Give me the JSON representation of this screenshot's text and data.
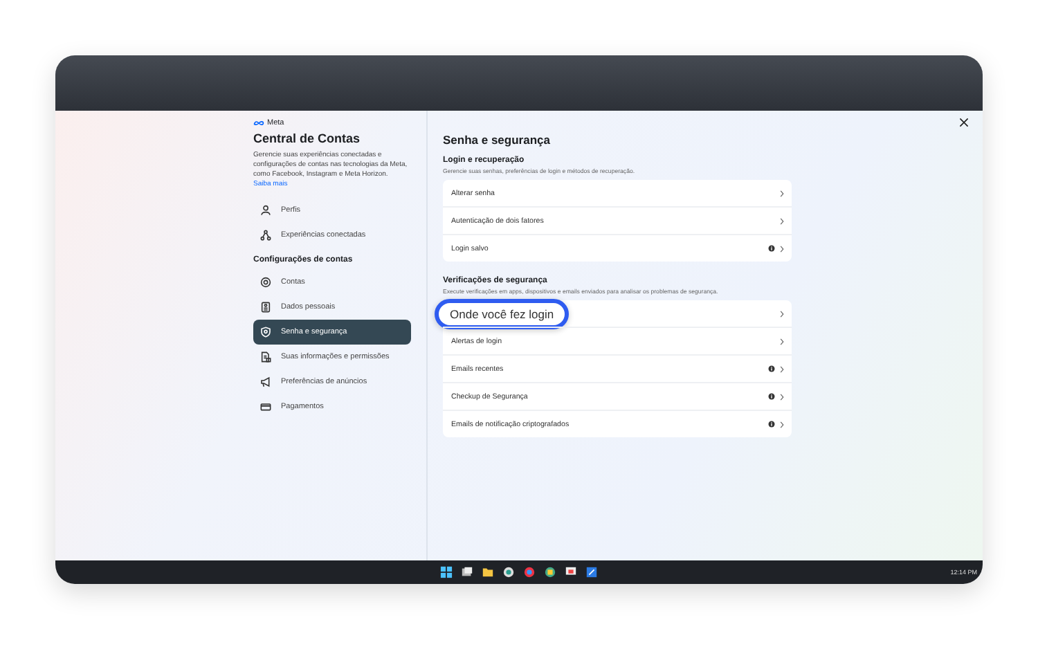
{
  "brand": "Meta",
  "title": "Central de Contas",
  "description": "Gerencie suas experiências conectadas e configurações de contas nas tecnologias da Meta, como Facebook, Instagram e Meta Horizon.",
  "learn_more": "Saiba mais",
  "nav_top": [
    {
      "label": "Perfis",
      "selected": false
    },
    {
      "label": "Experiências conectadas",
      "selected": false
    }
  ],
  "settings_heading": "Configurações de contas",
  "nav": [
    {
      "label": "Contas",
      "selected": false
    },
    {
      "label": "Dados pessoais",
      "selected": false
    },
    {
      "label": "Senha e segurança",
      "selected": true
    },
    {
      "label": "Suas informações e permissões",
      "selected": false
    },
    {
      "label": "Preferências de anúncios",
      "selected": false
    },
    {
      "label": "Pagamentos",
      "selected": false
    }
  ],
  "page_title": "Senha e segurança",
  "sections": [
    {
      "title": "Login e recuperação",
      "subtitle": "Gerencie suas senhas, preferências de login e métodos de recuperação.",
      "rows": [
        {
          "label": "Alterar senha",
          "info": false,
          "highlighted": false
        },
        {
          "label": "Autenticação de dois fatores",
          "info": false,
          "highlighted": false
        },
        {
          "label": "Login salvo",
          "info": true,
          "highlighted": false
        }
      ]
    },
    {
      "title": "Verificações de segurança",
      "subtitle": "Execute verificações em apps, dispositivos e emails enviados para analisar os problemas de segurança.",
      "rows": [
        {
          "label": "Onde você fez login",
          "info": false,
          "highlighted": true
        },
        {
          "label": "Alertas de login",
          "info": false,
          "highlighted": false
        },
        {
          "label": "Emails recentes",
          "info": true,
          "highlighted": false
        },
        {
          "label": "Checkup de Segurança",
          "info": true,
          "highlighted": false
        },
        {
          "label": "Emails de notificação criptografados",
          "info": true,
          "highlighted": false
        }
      ]
    }
  ],
  "taskbar": {
    "time": "12:14 PM"
  }
}
